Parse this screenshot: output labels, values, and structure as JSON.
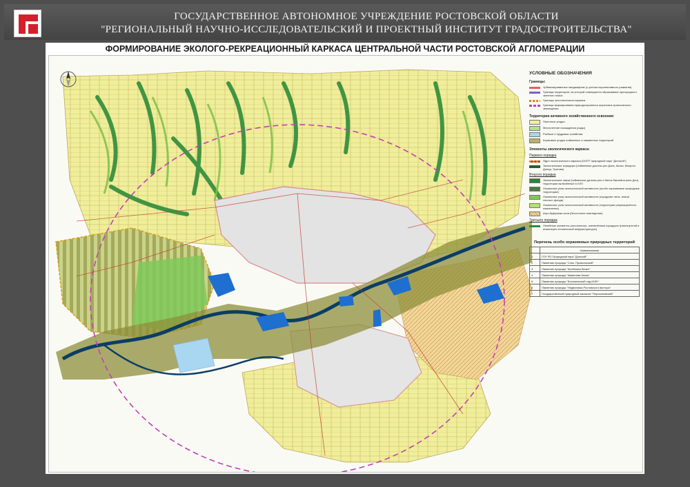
{
  "header": {
    "line1": "ГОСУДАРСТВЕННОЕ АВТОНОМНОЕ УЧРЕЖДЕНИЕ РОСТОВСКОЙ ОБЛАСТИ",
    "line2": "\"РЕГИОНАЛЬНЫЙ НАУЧНО-ИССЛЕДОВАТЕЛЬСКИЙ И ПРОЕКТНЫЙ ИНСТИТУТ ГРАДОСТРОИТЕЛЬСТВА\""
  },
  "map_title": "ФОРМИРОВАНИЕ ЭКОЛОГО-РЕКРЕАЦИОННЫЙ КАРКАСА ЦЕНТРАЛЬНОЙ ЧАСТИ РОСТОВСКОЙ АГЛОМЕРАЦИИ",
  "colors": {
    "header_bg": "#4e4e4e",
    "logo_red": "#d4202a",
    "farmland": "#f0ee9a",
    "forest_green": "#2e8b3a",
    "light_green": "#a7d96b",
    "olive": "#8d8f3a",
    "water": "#1f6fd1",
    "river": "#0b3d66",
    "urban": "#e3e3e3",
    "boundary_pink": "#c23fb3"
  },
  "legend": {
    "title": "УСЛОВНЫЕ ОБОЗНАЧЕНИЯ",
    "boundaries_title": "Границы:",
    "boundaries": [
      {
        "label": "Урбанизированных ландшафтов (с учетом перспективного развития)",
        "color": "#e06060",
        "kind": "line"
      },
      {
        "label": "Граница территории, на которой планируется образование пригородного зеленого пояса",
        "color": "#8060c0",
        "kind": "line"
      },
      {
        "label": "Границы экологического каркаса",
        "color": "#e08020",
        "kind": "line"
      },
      {
        "label": "Граница формирования природоохранного агропояса органического земледелия",
        "color": "#c23fb3",
        "kind": "line"
      }
    ],
    "active_title": "Территории активного хозяйственного освоения:",
    "active": [
      {
        "label": "Пахотные угодья",
        "color": "#f0ee9a"
      },
      {
        "label": "Многолетние насаждения (сады)",
        "color": "#b8e08a"
      },
      {
        "label": "Рыбные и прудовые хозяйства",
        "color": "#a9d7f2"
      },
      {
        "label": "Кормовые угодья пойменных и наименных территорий",
        "color": "#b9b26a"
      }
    ],
    "eco_title": "Элементы экологического каркаса:",
    "first_order": "Первого порядка",
    "first": [
      {
        "label": "Ядро экологического каркаса (ООПТ природный парк \"Донской\")",
        "color": "#e08020",
        "kind": "line"
      },
      {
        "label": "Экологические коридоры (пойменные долины рек Дона, Аксая, Мокрого Донца, Тузлова)",
        "color": "#2e5a2e",
        "kind": "line"
      }
    ],
    "second_order": "Второго порядка",
    "second": [
      {
        "label": "Экологические связи (пойменные долины рек и балок бассейна реки Дон), территории включённые в ЛЗП",
        "color": "#1f8a3a"
      },
      {
        "label": "Локальные узлы экологической активности (особо охраняемые природные территории)",
        "color": "#4d7a43"
      },
      {
        "label": "Локальные узлы экологической активности (городские леса, земли лесного фонда)",
        "color": "#7fc95a"
      },
      {
        "label": "Локальные узлы экологической активности (территории рекреационного назначения)",
        "color": "#b5e07a"
      },
      {
        "label": "Агро-буферная зона (бессточное земледелие)",
        "color": "#f3d79a"
      }
    ],
    "third_order": "Третьего порядка",
    "third": [
      {
        "label": "Линейные элементы (лесополосы, озеленённые коридоры транспортной и инженерно-технической инфраструктуры)",
        "color": "#2e8b3a",
        "kind": "line"
      }
    ]
  },
  "protected_areas": {
    "title": "Перечень особо охраняемых природных территорий",
    "header": [
      "",
      "Наименование"
    ],
    "rows": [
      {
        "n": "1",
        "name": "ГПУ РО Природный парк \"Донской\""
      },
      {
        "n": "2",
        "name": "Памятник природы \"Сопк. Приволжский\""
      },
      {
        "n": "3",
        "name": "Памятник природы \"Кутейская балка\""
      },
      {
        "n": "4",
        "name": "Памятник природы \"Каменная балка\""
      },
      {
        "n": "5",
        "name": "Памятник природы \"Ботанический сад ЮФУ\""
      },
      {
        "n": "6",
        "name": "Памятник природы \"Недвиговка Ростовского вахтора\""
      },
      {
        "n": "7",
        "name": "Государственный природный заказник \"Персиановский\""
      }
    ]
  }
}
